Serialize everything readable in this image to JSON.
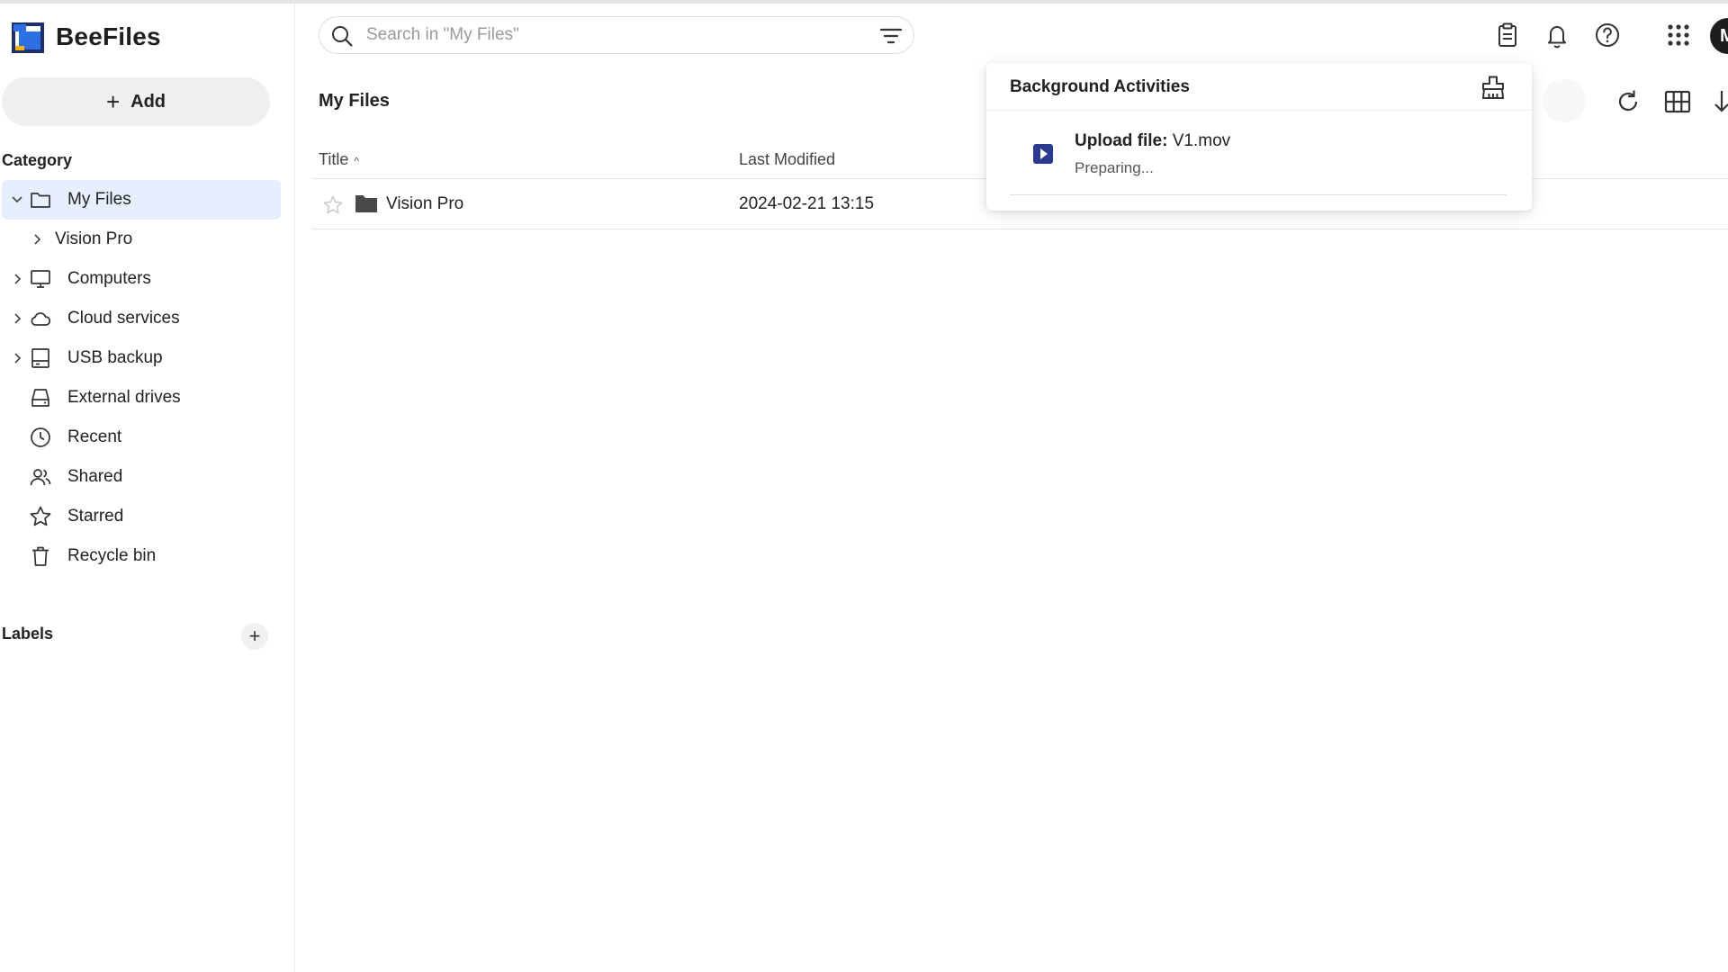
{
  "app": {
    "name": "BeeFiles",
    "brand_colors": {
      "blue": "#2f6fe4",
      "yellow": "#f4b400",
      "navy": "#1f2f6e"
    }
  },
  "sidebar": {
    "add_label": "Add",
    "category_title": "Category",
    "items": [
      {
        "label": "My Files",
        "icon": "folder-icon",
        "expanded": true,
        "active": true
      },
      {
        "label": "Vision Pro",
        "icon": "",
        "sub": true
      },
      {
        "label": "Computers",
        "icon": "monitor-icon"
      },
      {
        "label": "Cloud services",
        "icon": "cloud-icon"
      },
      {
        "label": "USB backup",
        "icon": "usb-drive-icon"
      },
      {
        "label": "External drives",
        "icon": "hard-drive-icon"
      },
      {
        "label": "Recent",
        "icon": "clock-icon"
      },
      {
        "label": "Shared",
        "icon": "people-icon"
      },
      {
        "label": "Starred",
        "icon": "star-icon"
      },
      {
        "label": "Recycle bin",
        "icon": "trash-icon"
      }
    ],
    "labels_title": "Labels",
    "labels_add": "+"
  },
  "header": {
    "search_placeholder": "Search in \"My Files\"",
    "avatar_initial": "M"
  },
  "main": {
    "title": "My Files",
    "columns": {
      "title": "Title",
      "title_sort": "^",
      "last_modified": "Last Modified"
    },
    "rows": [
      {
        "name": "Vision Pro",
        "type": "folder",
        "last_modified": "2024-02-21 13:15",
        "starred": false
      }
    ]
  },
  "background_activities": {
    "title": "Background Activities",
    "items": [
      {
        "action": "Upload file:",
        "file": "V1.mov",
        "status": "Preparing..."
      }
    ]
  }
}
